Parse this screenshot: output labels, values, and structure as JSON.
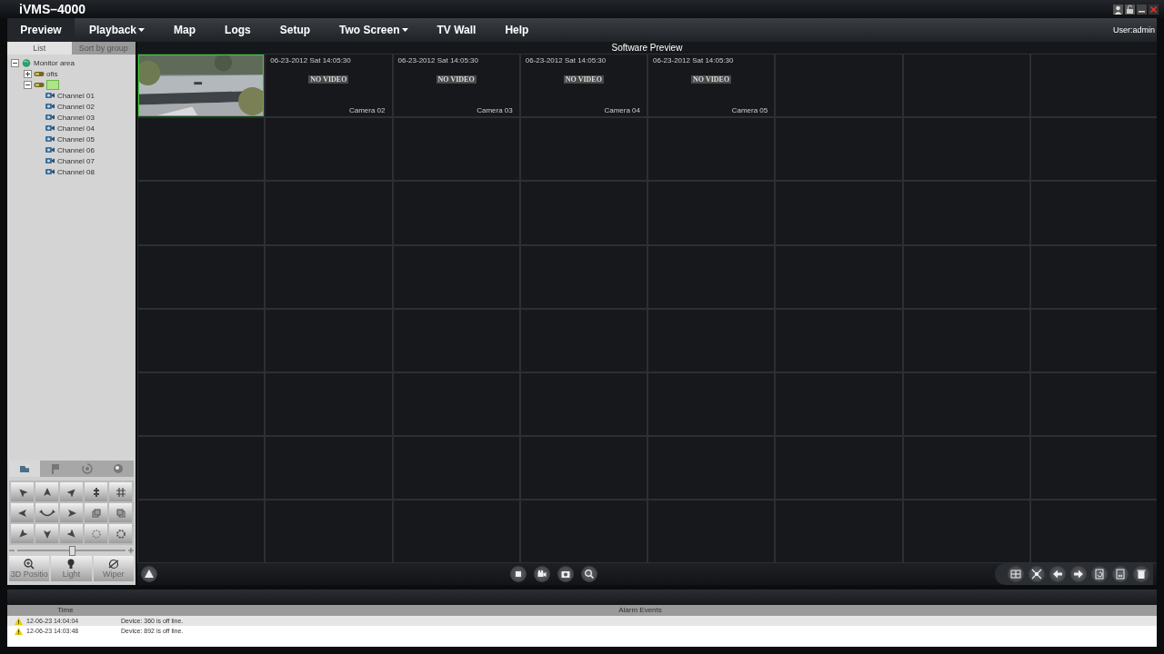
{
  "app": {
    "title": "iVMS–4000",
    "user": "User:admin"
  },
  "menu": [
    {
      "label": "Preview",
      "selected": true,
      "dropdown": false
    },
    {
      "label": "Playback",
      "selected": false,
      "dropdown": true
    },
    {
      "label": "Map",
      "selected": false,
      "dropdown": false
    },
    {
      "label": "Logs",
      "selected": false,
      "dropdown": false
    },
    {
      "label": "Setup",
      "selected": false,
      "dropdown": false
    },
    {
      "label": "Two Screen",
      "selected": false,
      "dropdown": true
    },
    {
      "label": "TV Wall",
      "selected": false,
      "dropdown": false
    },
    {
      "label": "Help",
      "selected": false,
      "dropdown": false
    }
  ],
  "sidebar": {
    "tabs": [
      {
        "label": "List",
        "selected": true
      },
      {
        "label": "Sort by group",
        "selected": false
      }
    ],
    "tree": [
      {
        "label": "Monitor area",
        "kind": "area",
        "expanded": true,
        "selected": false,
        "children": [
          {
            "label": "ofis",
            "kind": "device",
            "expanded": false,
            "selected": false
          },
          {
            "kind": "device",
            "expanded": true,
            "selected": true,
            "children": [
              {
                "label": "Channel 01",
                "kind": "channel",
                "selected": false
              },
              {
                "label": "Channel 02",
                "kind": "channel",
                "selected": false
              },
              {
                "label": "Channel 03",
                "kind": "channel",
                "selected": false
              },
              {
                "label": "Channel 04",
                "kind": "channel",
                "selected": false
              },
              {
                "label": "Channel 05",
                "kind": "channel",
                "selected": false
              },
              {
                "label": "Channel 06",
                "kind": "channel",
                "selected": false
              },
              {
                "label": "Channel 07",
                "kind": "channel",
                "selected": false
              },
              {
                "label": "Channel 08",
                "kind": "channel",
                "selected": false
              }
            ]
          }
        ]
      }
    ]
  },
  "ptz": {
    "tabs": [
      {
        "kind": "ptz",
        "selected": true
      },
      {
        "kind": "preset",
        "selected": false
      },
      {
        "kind": "patrol",
        "selected": false
      },
      {
        "kind": "pattern",
        "selected": false
      }
    ],
    "buttons": [
      {
        "kind": "up-left"
      },
      {
        "kind": "up"
      },
      {
        "kind": "up-right"
      },
      {
        "kind": "zoom"
      },
      {
        "kind": "grid"
      },
      {
        "kind": "left"
      },
      {
        "kind": "auto"
      },
      {
        "kind": "right"
      },
      {
        "kind": "focus"
      },
      {
        "kind": "iris"
      },
      {
        "kind": "down-left"
      },
      {
        "kind": "down"
      },
      {
        "kind": "down-right"
      },
      {
        "kind": "light-dots"
      },
      {
        "kind": "wiper-dots"
      }
    ],
    "speed": {
      "level": 0.5
    },
    "actions": [
      {
        "label": "3D Positio",
        "kind": "zoom"
      },
      {
        "label": "Light",
        "kind": "light"
      },
      {
        "label": "Wiper",
        "kind": "wiper"
      }
    ]
  },
  "preview": {
    "title": "Software Preview",
    "layout": {
      "kind": "split64"
    },
    "tiles": [
      {
        "kind": "picture",
        "selected": true
      },
      {
        "kind": "no_video",
        "selected": false,
        "timestamp": "06-23-2012 Sat 14:05:30",
        "status": "NO VIDEO",
        "camera": "Camera 02"
      },
      {
        "kind": "no_video",
        "selected": false,
        "timestamp": "06-23-2012 Sat 14:05:30",
        "status": "NO VIDEO",
        "camera": "Camera 03"
      },
      {
        "kind": "no_video",
        "selected": false,
        "timestamp": "06-23-2012 Sat 14:05:30",
        "status": "NO VIDEO",
        "camera": "Camera 04"
      },
      {
        "kind": "no_video",
        "selected": false,
        "timestamp": "06-23-2012 Sat 14:05:30",
        "status": "NO VIDEO",
        "camera": "Camera 05"
      }
    ],
    "toolbar_left": [
      {
        "kind": "alarm"
      }
    ],
    "toolbar_center": [
      {
        "kind": "stop"
      },
      {
        "kind": "record"
      },
      {
        "kind": "capture"
      },
      {
        "kind": "zoom"
      }
    ],
    "toolbar_right": [
      {
        "kind": "layout"
      },
      {
        "kind": "fullscreen"
      },
      {
        "kind": "prev"
      },
      {
        "kind": "next"
      },
      {
        "kind": "cycle"
      },
      {
        "kind": "split"
      },
      {
        "kind": "delete"
      }
    ]
  },
  "alarms": {
    "columns": [
      "Time",
      "Alarm Events"
    ],
    "rows": [
      {
        "time": "12-06-23 14:04:04",
        "event": "Device: 360 is off line."
      },
      {
        "time": "12-06-23 14:03:48",
        "event": "Device: 892 is off line."
      }
    ]
  }
}
